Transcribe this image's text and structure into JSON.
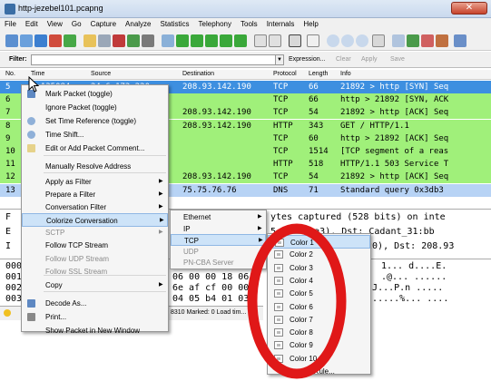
{
  "window": {
    "title": "http-jezebel101.pcapng"
  },
  "menubar": [
    "File",
    "Edit",
    "View",
    "Go",
    "Capture",
    "Analyze",
    "Statistics",
    "Telephony",
    "Tools",
    "Internals",
    "Help"
  ],
  "filter": {
    "label": "Filter:",
    "value": "",
    "expression": "Expression...",
    "clear": "Clear",
    "apply": "Apply",
    "save": "Save"
  },
  "columns": {
    "no": "No.",
    "time": "Time",
    "source": "Source",
    "destination": "Destination",
    "protocol": "Protocol",
    "length": "Length",
    "info": "Info"
  },
  "packets": [
    {
      "no": "5",
      "time": "9.135084",
      "source": "24.6.173.220",
      "destination": "208.93.142.190",
      "protocol": "TCP",
      "length": "66",
      "info": "21892 > http [SYN] Seq",
      "bg": "#3d8fe0",
      "fg": "#ffffff"
    },
    {
      "no": "6",
      "time": "",
      "source": "24.6.173.220",
      "destination": "",
      "protocol": "TCP",
      "length": "66",
      "info": "http > 21892 [SYN, ACK",
      "bg": "#a0f07a",
      "fg": "#000000"
    },
    {
      "no": "7",
      "time": "",
      "source": "",
      "destination": "208.93.142.190",
      "protocol": "TCP",
      "length": "54",
      "info": "21892 > http [ACK] Seq",
      "bg": "#a0f07a",
      "fg": "#000000"
    },
    {
      "no": "8",
      "time": "",
      "source": "",
      "destination": "208.93.142.190",
      "protocol": "HTTP",
      "length": "343",
      "info": "GET / HTTP/1.1",
      "bg": "#a0f07a",
      "fg": "#000000"
    },
    {
      "no": "9",
      "time": "",
      "source": "24.6.173.220",
      "destination": "",
      "protocol": "TCP",
      "length": "60",
      "info": "http > 21892 [ACK] Seq",
      "bg": "#a0f07a",
      "fg": "#000000"
    },
    {
      "no": "10",
      "time": "",
      "source": "24.6.173.220",
      "destination": "",
      "protocol": "TCP",
      "length": "1514",
      "info": "[TCP segment of a reas",
      "bg": "#a0f07a",
      "fg": "#000000"
    },
    {
      "no": "11",
      "time": "",
      "source": "24.6.173.220",
      "destination": "",
      "protocol": "HTTP",
      "length": "518",
      "info": "HTTP/1.1 503 Service T",
      "bg": "#a0f07a",
      "fg": "#000000"
    },
    {
      "no": "12",
      "time": "",
      "source": "",
      "destination": "208.93.142.190",
      "protocol": "TCP",
      "length": "54",
      "info": "21892 > http [ACK] Seq",
      "bg": "#a0f07a",
      "fg": "#000000"
    },
    {
      "no": "13",
      "time": "",
      "source": "",
      "destination": "75.75.76.76",
      "protocol": "DNS",
      "length": "71",
      "info": "Standard query 0x3db3",
      "bg": "#b7d3f5",
      "fg": "#000000"
    }
  ],
  "details": [
    {
      "exp": "F",
      "text": "ytes captured (528 bits) on inte"
    },
    {
      "exp": "E",
      "text": "5:6c:bf:a3), Dst: Cadant_31:bb"
    },
    {
      "exp": "I",
      "text": "220), Dst: 208.93"
    }
  ],
  "hex": [
    {
      "off": "000",
      "bytes": "",
      "ascii": "1... d....E."
    },
    {
      "off": "001",
      "bytes": "06 00 00 18 06",
      "ascii": ".@... ......"
    },
    {
      "off": "002",
      "bytes": "6e af cf 00 00",
      "ascii": "...J...P.n ....."
    },
    {
      "off": "003",
      "bytes": "04 05 b4 01 03",
      "ascii": "........%... ...."
    }
  ],
  "status": {
    "text": "8310 Marked: 0 Load tim...",
    "profile": "Pr"
  },
  "context_menu": [
    {
      "label": "Mark Packet (toggle)",
      "icon": "mark-icon",
      "disabled": false,
      "sub": false
    },
    {
      "label": "Ignore Packet (toggle)",
      "icon": "",
      "disabled": false,
      "sub": false
    },
    {
      "label": "Set Time Reference (toggle)",
      "icon": "clock-icon",
      "disabled": false,
      "sub": false
    },
    {
      "label": "Time Shift...",
      "icon": "clock-icon",
      "disabled": false,
      "sub": false
    },
    {
      "label": "Edit or Add Packet Comment...",
      "icon": "comment-icon",
      "disabled": false,
      "sub": false
    },
    {
      "label": "Manually Resolve Address",
      "icon": "",
      "disabled": false,
      "sub": false
    },
    {
      "label": "Apply as Filter",
      "icon": "",
      "disabled": false,
      "sub": true
    },
    {
      "label": "Prepare a Filter",
      "icon": "",
      "disabled": false,
      "sub": true
    },
    {
      "label": "Conversation Filter",
      "icon": "",
      "disabled": false,
      "sub": true
    },
    {
      "label": "Colorize Conversation",
      "icon": "",
      "disabled": false,
      "sub": true,
      "highlight": true
    },
    {
      "label": "SCTP",
      "icon": "",
      "disabled": true,
      "sub": true
    },
    {
      "label": "Follow TCP Stream",
      "icon": "",
      "disabled": false,
      "sub": false
    },
    {
      "label": "Follow UDP Stream",
      "icon": "",
      "disabled": true,
      "sub": false
    },
    {
      "label": "Follow SSL Stream",
      "icon": "",
      "disabled": true,
      "sub": false
    },
    {
      "label": "Copy",
      "icon": "",
      "disabled": false,
      "sub": true
    },
    {
      "label": "Decode As...",
      "icon": "decode-icon",
      "disabled": false,
      "sub": false
    },
    {
      "label": "Print...",
      "icon": "print-icon",
      "disabled": false,
      "sub": false
    },
    {
      "label": "Show Packet in New Window",
      "icon": "",
      "disabled": false,
      "sub": false
    }
  ],
  "colorize_submenu": [
    {
      "label": "Ethernet",
      "disabled": false
    },
    {
      "label": "IP",
      "disabled": false
    },
    {
      "label": "TCP",
      "disabled": false,
      "highlight": true
    },
    {
      "label": "UDP",
      "disabled": true
    },
    {
      "label": "PN-CBA Server",
      "disabled": true
    }
  ],
  "tcp_submenu": [
    "Color 1",
    "Color 2",
    "Color 3",
    "Color 4",
    "Color 5",
    "Color 6",
    "Color 7",
    "Color 8",
    "Color 9",
    "Color 10",
    "...oring Rule..."
  ],
  "colors": {
    "accent": "#3d8fe0",
    "tcp_green": "#a0f07a",
    "dns_blue": "#b7d3f5",
    "highlight_oval": "#e01818"
  }
}
